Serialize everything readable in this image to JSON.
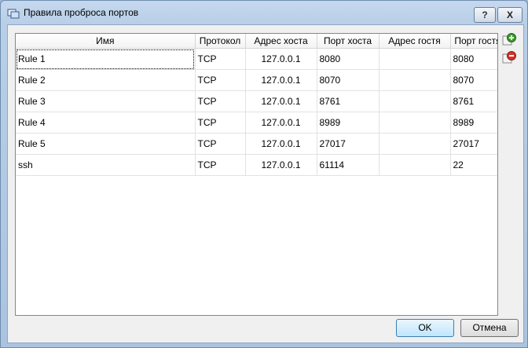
{
  "window": {
    "title": "Правила проброса портов"
  },
  "titlebar": {
    "help_label": "?",
    "close_label": "X"
  },
  "table": {
    "headers": [
      "Имя",
      "Протокол",
      "Адрес хоста",
      "Порт хоста",
      "Адрес гостя",
      "Порт гостя"
    ],
    "rows": [
      [
        "Rule 1",
        "TCP",
        "127.0.0.1",
        "8080",
        "",
        "8080"
      ],
      [
        "Rule 2",
        "TCP",
        "127.0.0.1",
        "8070",
        "",
        "8070"
      ],
      [
        "Rule 3",
        "TCP",
        "127.0.0.1",
        "8761",
        "",
        "8761"
      ],
      [
        "Rule 4",
        "TCP",
        "127.0.0.1",
        "8989",
        "",
        "8989"
      ],
      [
        "Rule 5",
        "TCP",
        "127.0.0.1",
        "27017",
        "",
        "27017"
      ],
      [
        "ssh",
        "TCP",
        "127.0.0.1",
        "61114",
        "",
        "22"
      ]
    ]
  },
  "buttons": {
    "ok": "OK",
    "cancel": "Отмена"
  },
  "icons": {
    "add": "add-rule-icon",
    "remove": "remove-rule-icon"
  },
  "colors": {
    "add_green": "#3a9b2a",
    "remove_red": "#d0352a"
  }
}
